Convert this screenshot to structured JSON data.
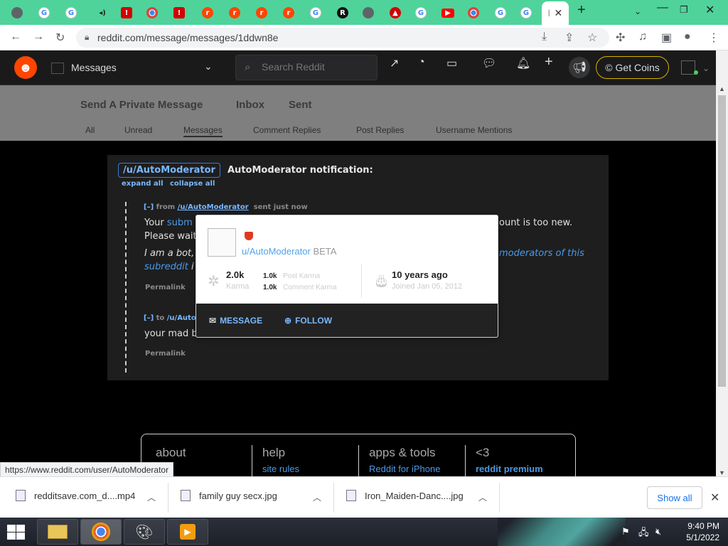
{
  "browser": {
    "url": "reddit.com/message/messages/1ddwn8e",
    "tabs_favicons": [
      "globe",
      "google",
      "google",
      "audio",
      "red",
      "chrome",
      "red",
      "reddit",
      "reddit",
      "reddit",
      "reddit",
      "google",
      "r-dark",
      "globe",
      "red-badge",
      "google",
      "youtube",
      "chrome",
      "google",
      "google"
    ]
  },
  "header": {
    "section_title": "Messages",
    "search_placeholder": "Search Reddit",
    "coins_label": "Get Coins"
  },
  "message_nav": {
    "top_tabs": [
      "Send A Private Message",
      "Inbox",
      "Sent"
    ],
    "sub_tabs": [
      "All",
      "Unread",
      "Messages",
      "Comment Replies",
      "Post Replies",
      "Username Mentions"
    ],
    "selected_sub_tab": "Messages"
  },
  "thread": {
    "sender": "/u/AutoModerator",
    "subject": "AutoModerator notification:",
    "expand_all": "expand all",
    "collapse_all": "collapse all",
    "msg1": {
      "toggle": "[–]",
      "from_label": "from",
      "user": "/u/AutoModerator",
      "time": "sent just now",
      "line1_start": "Your",
      "line1_link": "subm",
      "line1_end": "ount is too new.",
      "line2": "Please wait",
      "bot_text": "I am a bot,",
      "bot_link": "moderators of this",
      "line4_link": "subreddit",
      "line4_end": "i",
      "permalink": "Permalink"
    },
    "msg2": {
      "toggle": "[–]",
      "to_label": "to",
      "user": "/u/Auto",
      "body": "your mad b",
      "permalink": "Permalink"
    }
  },
  "hovercard": {
    "username": "u/AutoModerator",
    "beta": "BETA",
    "karma_total": "2.0k",
    "karma_label": "Karma",
    "post_karma": "1.0k",
    "post_karma_label": "Post Karma",
    "comment_karma": "1.0k",
    "comment_karma_label": "Comment Karma",
    "age": "10 years ago",
    "joined": "Joined Jan 05, 2012",
    "message_btn": "MESSAGE",
    "follow_btn": "FOLLOW"
  },
  "footer": {
    "cols": [
      {
        "head": "about",
        "link": ""
      },
      {
        "head": "help",
        "link": "site rules"
      },
      {
        "head": "apps & tools",
        "link": "Reddit for iPhone"
      },
      {
        "head": "<3",
        "link": "reddit premium"
      }
    ]
  },
  "status_url": "https://www.reddit.com/user/AutoModerator",
  "downloads": {
    "items": [
      "redditsave.com_d....mp4",
      "family guy secx.jpg",
      "Iron_Maiden-Danc....jpg"
    ],
    "show_all": "Show all"
  },
  "taskbar": {
    "time": "9:40 PM",
    "date": "5/1/2022"
  }
}
